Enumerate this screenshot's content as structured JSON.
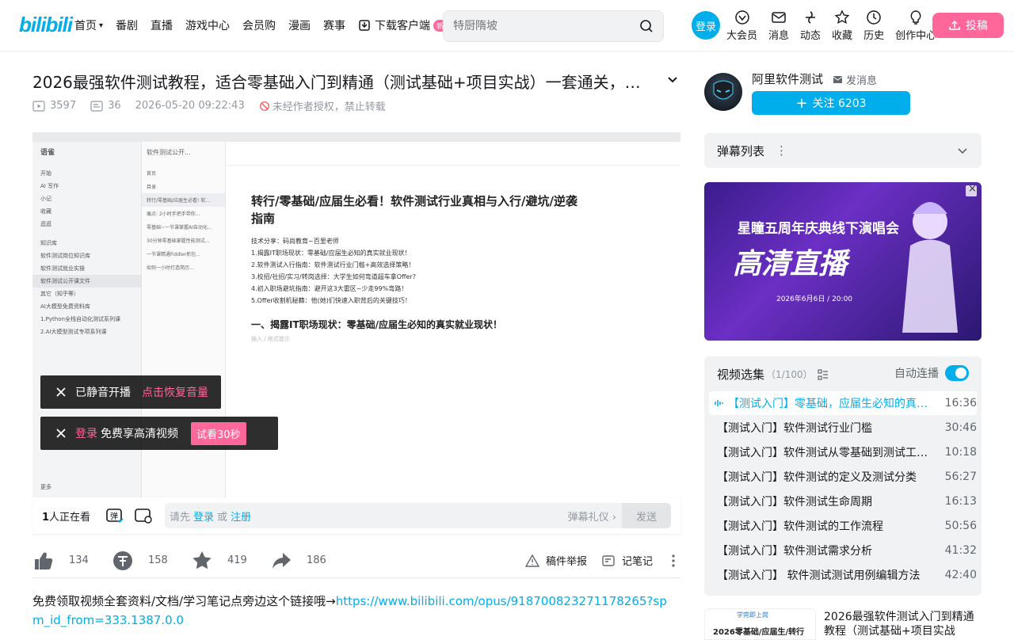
{
  "header": {
    "logo": "bilibili",
    "nav": [
      {
        "label": "首页",
        "dropdown": true
      },
      {
        "label": "番剧"
      },
      {
        "label": "直播"
      },
      {
        "label": "游戏中心"
      },
      {
        "label": "会员购"
      },
      {
        "label": "漫画"
      },
      {
        "label": "赛事"
      }
    ],
    "download_label": "下载客户端",
    "download_badge": "新",
    "search_placeholder": "特厨隋坡",
    "login_label": "登录",
    "icons": [
      {
        "label": "大会员",
        "icon": "vip-icon"
      },
      {
        "label": "消息",
        "icon": "message-icon"
      },
      {
        "label": "动态",
        "icon": "dynamic-icon"
      },
      {
        "label": "收藏",
        "icon": "favorite-icon"
      },
      {
        "label": "历史",
        "icon": "history-icon"
      },
      {
        "label": "创作中心",
        "icon": "creator-icon"
      }
    ],
    "upload_label": "投稿",
    "accent": "#00aeec",
    "pink": "#ff6699"
  },
  "video": {
    "title": "2026最强软件测试教程，适合零基础入门到精通（测试基础+项目实战）一套通关，学完即可就业",
    "views": "3597",
    "danmaku_count": "36",
    "date": "2026-05-20 09:22:43",
    "copyright": "未经作者授权，禁止转载"
  },
  "player": {
    "doc_title": "转行/零基础/应届生必看！软件测试行业真相与入行/避坑/逆袭指南",
    "doc_lines": [
      "技术分享：码尚教育~百里老师",
      "1.揭露IT职场现状：零基础/应届生必知的真实就业现状！",
      "2.软件测试入行指南：软件测试行业门槛+高效选择策略！",
      "3.校招/社招/实习/转岗选择：大学生如何弯道超车拿Offer?",
      "4.初入职场避坑指南：避开这3大雷区~少走99%弯路！",
      "5.Offer收割机秘籍：他(她)们快速入职背后的关键技巧！"
    ],
    "doc_h1": "一、揭露IT职场现状：零基础/应届生必知的真实就业现状！",
    "doc_hint": "插入 / 格式提示",
    "left_rows": [
      "语雀",
      "开始",
      "AI 写作",
      "小记",
      "收藏",
      "逛逛",
      "知识库",
      "软件测试岗位知识库",
      "软件测试就业实操",
      "软件测试公开课文件",
      "其它（知乎等）",
      "AI大模型免费资料库",
      "1.Python全栈自动化测试系列课",
      "2.AI大模型测试专项系列课",
      "更多"
    ],
    "mid_rows": [
      "软件测试公开...",
      "首页",
      "目录",
      "转行/零基础/应届生必看! 软...",
      "痛点: 2小时手把手带你...",
      "零基础~一节课掌握AI自动化...",
      "30分钟零基础掌握性能测试...",
      "一节课精通Fiddler抓包...",
      "如何一小时打造简历..."
    ],
    "toast_mute_text": "已静音开播",
    "toast_mute_action": "点击恢复音量",
    "toast_login_link": "登录",
    "toast_login_text": "免费享高清视频",
    "toast_try": "试看30秒"
  },
  "danmaku_bar": {
    "watching_num": "1",
    "watching_text": "人正在看",
    "prompt_prefix": "请先",
    "login": "登录",
    "or": "或",
    "register": "注册",
    "etiquette": "弹幕礼仪",
    "send": "发送"
  },
  "actions": {
    "like": "134",
    "coin": "158",
    "favorite": "419",
    "share": "186",
    "report": "稿件举报",
    "notes": "记笔记"
  },
  "description": {
    "text": "免费领取视频全套资料/文档/学习笔记点旁边这个链接哦→",
    "link": "https://www.bilibili.com/opus/918700823271178265?spm_id_from=333.1387.0.0"
  },
  "uploader": {
    "name": "阿里软件测试",
    "message": "发消息",
    "follow": "关注 6203"
  },
  "danmaku_list": {
    "label": "弹幕列表"
  },
  "ad": {
    "headline": "星瞳五周年庆典线下演唱会",
    "big": "高清直播",
    "sub": "2026年6月6日 / 20:00"
  },
  "playlist": {
    "title": "视频选集",
    "count": "（1/100）",
    "autoplay": "自动连播",
    "episodes": [
      {
        "title": "【测试入门】零基础，应届生必知的真实就业现状",
        "duration": "16:36",
        "active": true
      },
      {
        "title": "【测试入门】软件测试行业门槛",
        "duration": "30:46"
      },
      {
        "title": "【测试入门】软件测试从零基础到测试工程师",
        "duration": "10:18"
      },
      {
        "title": "【测试入门】软件测试的定义及测试分类",
        "duration": "56:27"
      },
      {
        "title": "【测试入门】软件测试生命周期",
        "duration": "16:13"
      },
      {
        "title": "【测试入门】软件测试的工作流程",
        "duration": "50:56"
      },
      {
        "title": "【测试入门】软件测试需求分析",
        "duration": "41:32"
      },
      {
        "title": "【测试入门】 软件测试测试用例编辑方法",
        "duration": "42:40"
      }
    ]
  },
  "recommend": {
    "thumb_brand": "学完即上岗",
    "thumb_text": "2026零基础/应届生/转行",
    "title": "2026最强软件测试入门到精通教程（测试基础+项目实战"
  }
}
